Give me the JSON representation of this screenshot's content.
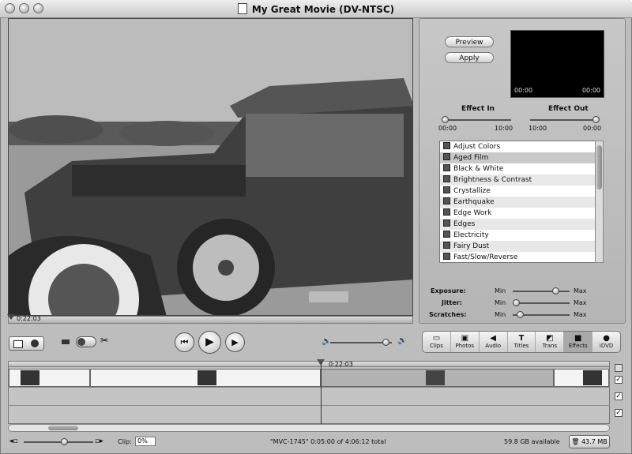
{
  "window": {
    "title": "My Great Movie (DV-NTSC)"
  },
  "viewer": {
    "timecode": "0:22:03"
  },
  "effects_panel": {
    "preview_button": "Preview",
    "apply_button": "Apply",
    "preview_time_left": "00:00",
    "preview_time_right": "00:00",
    "effect_in": {
      "label": "Effect In",
      "min": "00:00",
      "max": "10:00"
    },
    "effect_out": {
      "label": "Effect Out",
      "min": "10:00",
      "max": "00:00"
    },
    "effects": [
      "Adjust Colors",
      "Aged Film",
      "Black & White",
      "Brightness & Contrast",
      "Crystallize",
      "Earthquake",
      "Edge Work",
      "Edges",
      "Electricity",
      "Fairy Dust",
      "Fast/Slow/Reverse"
    ],
    "selected_effect": "Aged Film",
    "params": [
      {
        "label": "Exposure:",
        "min": "Min",
        "max": "Max",
        "level": 0.75
      },
      {
        "label": "Jitter:",
        "min": "Min",
        "max": "Max",
        "level": 0.05
      },
      {
        "label": "Scratches:",
        "min": "Min",
        "max": "Max",
        "level": 0.12
      }
    ]
  },
  "playback": {
    "rewind_icon": "rewind-icon",
    "play_icon": "play-icon",
    "fullscreen_icon": "fullscreen-play-icon",
    "volume_level": 0.9
  },
  "toolbar": {
    "tools": [
      {
        "label": "Clips",
        "icon": "clips-icon"
      },
      {
        "label": "Photos",
        "icon": "photos-icon"
      },
      {
        "label": "Audio",
        "icon": "audio-icon"
      },
      {
        "label": "Titles",
        "icon": "titles-icon"
      },
      {
        "label": "Trans",
        "icon": "transitions-icon"
      },
      {
        "label": "Effects",
        "icon": "effects-icon",
        "active": true
      },
      {
        "label": "iDVD",
        "icon": "idvd-icon"
      }
    ]
  },
  "timeline": {
    "playhead_time": "0:22:03"
  },
  "status": {
    "clip_label": "Clip:",
    "clip_value": "0%",
    "clip_info": "\"MVC-1745\"  0:05:00 of 4:06:12 total",
    "disk_available": "59.8 GB available",
    "trash_label": "43.7 MB"
  }
}
